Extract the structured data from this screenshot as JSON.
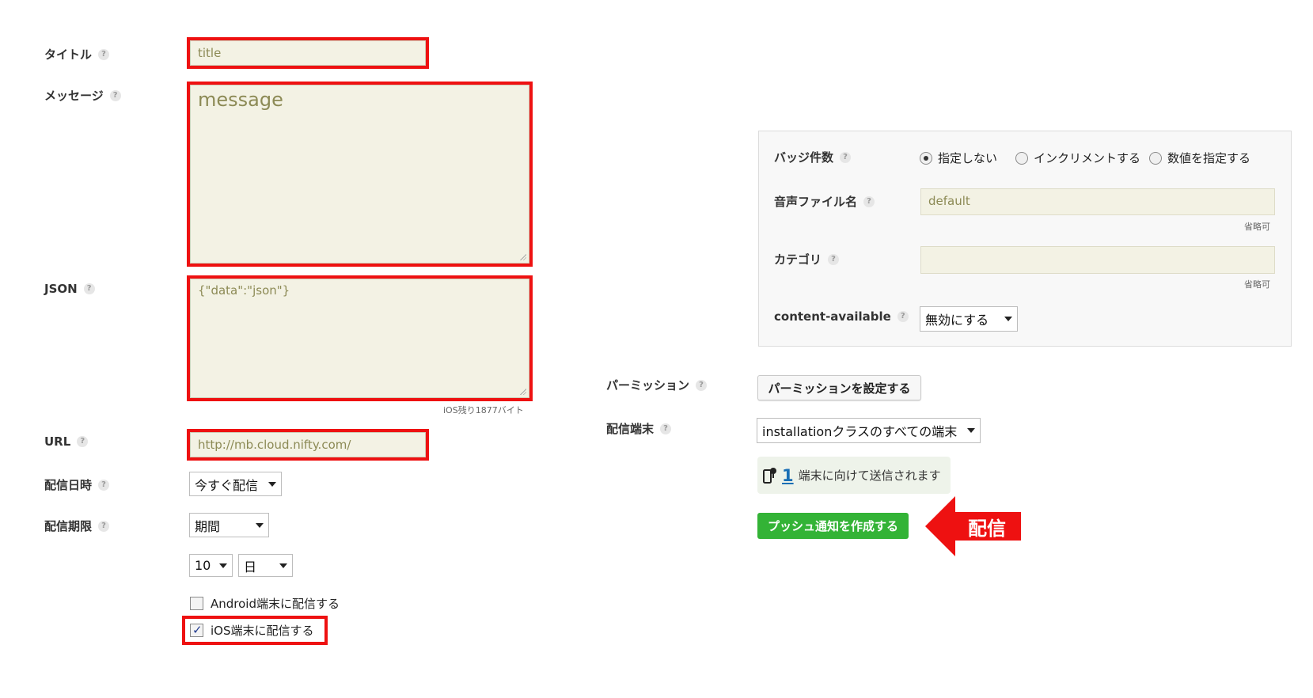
{
  "form": {
    "title_label": "タイトル",
    "title_value": "title",
    "message_label": "メッセージ",
    "message_value": "message",
    "json_label": "JSON",
    "json_value": "{\"data\":\"json\"}",
    "json_remaining": "iOS残り1877バイト",
    "url_label": "URL",
    "url_value": "http://mb.cloud.nifty.com/",
    "delivery_time_label": "配信日時",
    "delivery_time_value": "今すぐ配信",
    "expiry_label": "配信期限",
    "expiry_value": "期間",
    "expiry_number": "10",
    "expiry_unit": "日",
    "android_label": "Android端末に配信する",
    "android_checked": false,
    "ios_label": "iOS端末に配信する",
    "ios_checked": true,
    "help_glyph": "?"
  },
  "ios_panel": {
    "badge_label": "バッジ件数",
    "badge_options": [
      "指定しない",
      "インクリメントする",
      "数値を指定する"
    ],
    "badge_selected": "指定しない",
    "sound_label": "音声ファイル名",
    "sound_value": "default",
    "sound_note": "省略可",
    "category_label": "カテゴリ",
    "category_value": "",
    "category_note": "省略可",
    "content_available_label": "content-available",
    "content_available_value": "無効にする"
  },
  "permission": {
    "label": "パーミッション",
    "button": "パーミッションを設定する"
  },
  "target": {
    "label": "配信端末",
    "value": "installationクラスのすべての端末",
    "count": "1",
    "count_suffix": "端末に向けて送信されます"
  },
  "actions": {
    "create_button": "プッシュ通知を作成する",
    "callout": "配信"
  },
  "colors": {
    "highlight": "#ee1111",
    "field_bg": "#f3f2e4",
    "primary_button": "#33b336",
    "link": "#1a6fb5"
  }
}
